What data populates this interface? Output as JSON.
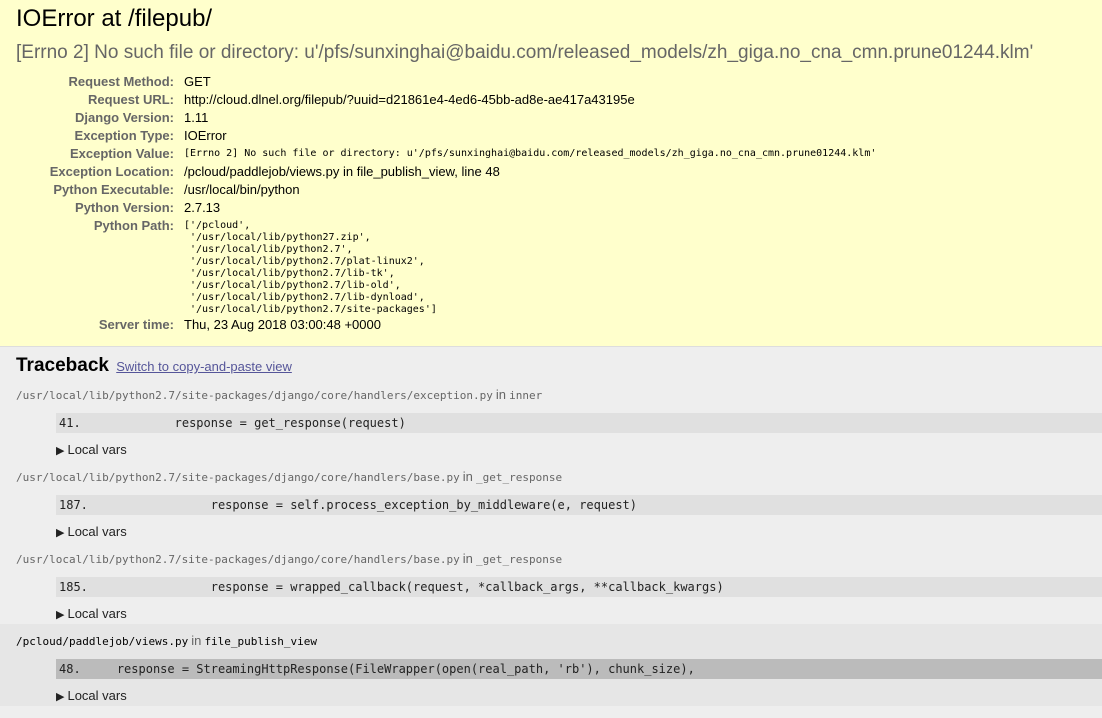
{
  "summary": {
    "title": "IOError at /filepub/",
    "message": "[Errno 2] No such file or directory: u'/pfs/sunxinghai@baidu.com/released_models/zh_giga.no_cna_cmn.prune01244.klm'",
    "rows": [
      {
        "label": "Request Method:",
        "value": "GET"
      },
      {
        "label": "Request URL:",
        "value": "http://cloud.dlnel.org/filepub/?uuid=d21861e4-4ed6-45bb-ad8e-ae417a43195e"
      },
      {
        "label": "Django Version:",
        "value": "1.11"
      },
      {
        "label": "Exception Type:",
        "value": "IOError"
      },
      {
        "label": "Exception Value:",
        "value": "[Errno 2] No such file or directory: u'/pfs/sunxinghai@baidu.com/released_models/zh_giga.no_cna_cmn.prune01244.klm'"
      },
      {
        "label": "Exception Location:",
        "value": "/pcloud/paddlejob/views.py in file_publish_view, line 48"
      },
      {
        "label": "Python Executable:",
        "value": "/usr/local/bin/python"
      },
      {
        "label": "Python Version:",
        "value": "2.7.13"
      },
      {
        "label": "Python Path:",
        "value": "['/pcloud',\n '/usr/local/lib/python27.zip',\n '/usr/local/lib/python2.7',\n '/usr/local/lib/python2.7/plat-linux2',\n '/usr/local/lib/python2.7/lib-tk',\n '/usr/local/lib/python2.7/lib-old',\n '/usr/local/lib/python2.7/lib-dynload',\n '/usr/local/lib/python2.7/site-packages']"
      },
      {
        "label": "Server time:",
        "value": "Thu, 23 Aug 2018 03:00:48 +0000"
      }
    ]
  },
  "traceback": {
    "heading": "Traceback",
    "switch_link": "Switch to copy-and-paste view",
    "in_word": "in",
    "local_vars_label": "Local vars",
    "frames": [
      {
        "file": "/usr/local/lib/python2.7/site-packages/django/core/handlers/exception.py",
        "func": "inner",
        "lineno": "41.",
        "code": "            response = get_response(request)"
      },
      {
        "file": "/usr/local/lib/python2.7/site-packages/django/core/handlers/base.py",
        "func": "_get_response",
        "lineno": "187.",
        "code": "                response = self.process_exception_by_middleware(e, request)"
      },
      {
        "file": "/usr/local/lib/python2.7/site-packages/django/core/handlers/base.py",
        "func": "_get_response",
        "lineno": "185.",
        "code": "                response = wrapped_callback(request, *callback_args, **callback_kwargs)"
      },
      {
        "file": "/pcloud/paddlejob/views.py",
        "func": "file_publish_view",
        "lineno": "48.",
        "code": "    response = StreamingHttpResponse(FileWrapper(open(real_path, 'rb'), chunk_size),"
      }
    ]
  },
  "icons": {
    "expand": "triangle-right-icon"
  }
}
